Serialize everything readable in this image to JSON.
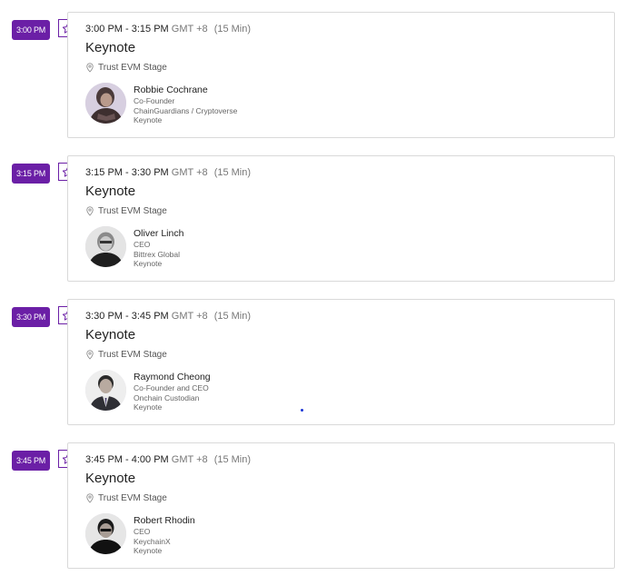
{
  "sessions": [
    {
      "badge": "3:00 PM",
      "time_range": "3:00 PM - 3:15 PM",
      "timezone": "GMT +8",
      "duration": "(15 Min)",
      "title": "Keynote",
      "venue": "Trust EVM Stage",
      "speaker": {
        "name": "Robbie Cochrane",
        "role": "Co-Founder",
        "company": "ChainGuardians / Cryptoverse",
        "type": "Keynote"
      }
    },
    {
      "badge": "3:15 PM",
      "time_range": "3:15 PM - 3:30 PM",
      "timezone": "GMT +8",
      "duration": "(15 Min)",
      "title": "Keynote",
      "venue": "Trust EVM Stage",
      "speaker": {
        "name": "Oliver Linch",
        "role": "CEO",
        "company": "Bittrex Global",
        "type": "Keynote"
      }
    },
    {
      "badge": "3:30 PM",
      "time_range": "3:30 PM - 3:45 PM",
      "timezone": "GMT +8",
      "duration": "(15 Min)",
      "title": "Keynote",
      "venue": "Trust EVM Stage",
      "speaker": {
        "name": "Raymond Cheong",
        "role": "Co-Founder and CEO",
        "company": "Onchain Custodian",
        "type": "Keynote"
      }
    },
    {
      "badge": "3:45 PM",
      "time_range": "3:45 PM - 4:00 PM",
      "timezone": "GMT +8",
      "duration": "(15 Min)",
      "title": "Keynote",
      "venue": "Trust EVM Stage",
      "speaker": {
        "name": "Robert Rhodin",
        "role": "CEO",
        "company": "KeychainX",
        "type": "Keynote"
      }
    }
  ],
  "icons": {
    "favorite": "star-outline-icon",
    "venue": "location-pin-icon"
  },
  "colors": {
    "accent": "#6b1fa6",
    "card_border": "#d9d9d9",
    "muted_text": "#777777"
  }
}
